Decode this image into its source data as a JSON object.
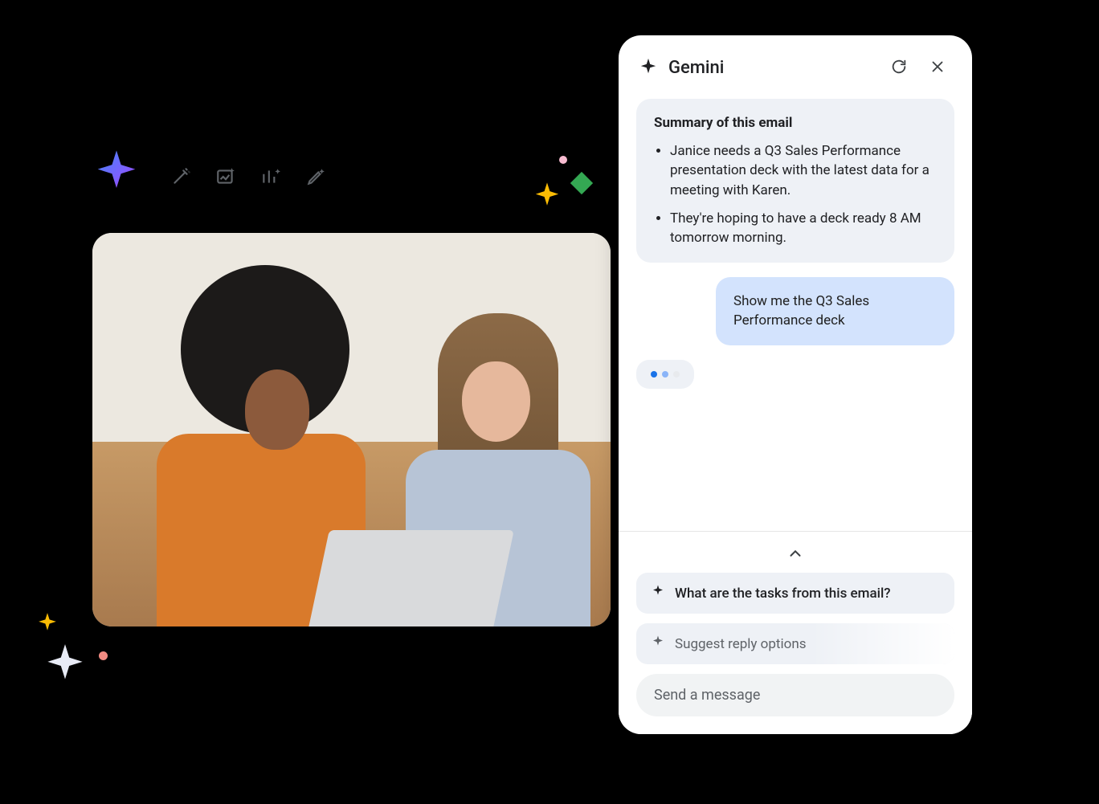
{
  "decor_icons": {
    "gradient_sparkle": "gradient-sparkle-icon",
    "toolbar": [
      "magic-wand-icon",
      "image-sparkle-icon",
      "chart-sparkle-icon",
      "pen-sparkle-icon"
    ]
  },
  "photo": {
    "alt": "Two women collaborating over a laptop on a sofa"
  },
  "gemini": {
    "title": "Gemini",
    "refresh_tooltip": "Refresh",
    "close_tooltip": "Close",
    "summary": {
      "title": "Summary of this email",
      "bullets": [
        "Janice needs a Q3 Sales Performance presentation deck with the latest data for a meeting with Karen.",
        "They're hoping to have a deck ready 8 AM tomorrow morning."
      ]
    },
    "user_msg": "Show me the Q3 Sales Performance deck",
    "typing_label": "Gemini is typing",
    "suggestions": [
      "What are the tasks from this email?",
      "Suggest reply options"
    ],
    "composer_placeholder": "Send a message"
  }
}
